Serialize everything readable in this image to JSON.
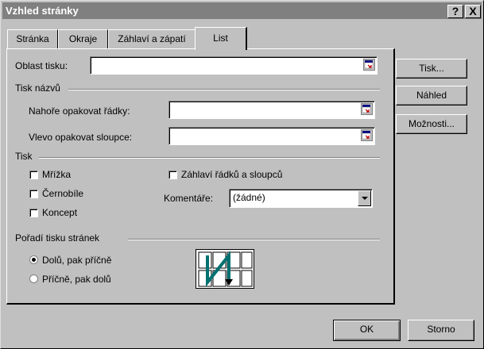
{
  "window": {
    "title": "Vzhled stránky",
    "help_label": "?",
    "close_label": "X"
  },
  "tabs": [
    {
      "label": "Stránka",
      "active": false
    },
    {
      "label": "Okraje",
      "active": false
    },
    {
      "label": "Záhlaví a zápatí",
      "active": false
    },
    {
      "label": "List",
      "active": true
    }
  ],
  "print_area": {
    "label": "Oblast tisku:",
    "value": ""
  },
  "print_titles": {
    "heading": "Tisk názvů",
    "rows_label": "Nahoře opakovat řádky:",
    "rows_value": "",
    "cols_label": "Vlevo opakovat sloupce:",
    "cols_value": ""
  },
  "print": {
    "heading": "Tisk",
    "gridlines": {
      "label": "Mřížka",
      "checked": false
    },
    "black_white": {
      "label": "Černobíle",
      "checked": false
    },
    "draft": {
      "label": "Koncept",
      "checked": false
    },
    "headings": {
      "label": "Záhlaví řádků a sloupců",
      "checked": false
    },
    "comments_label": "Komentáře:",
    "comments_value": "(žádné)"
  },
  "page_order": {
    "heading": "Pořadí tisku stránek",
    "down_then_over": {
      "label": "Dolů, pak příčně",
      "selected": true
    },
    "over_then_down": {
      "label": "Příčně, pak dolů",
      "selected": false
    }
  },
  "side_buttons": {
    "print": "Tisk...",
    "preview": "Náhled",
    "options": "Možnosti..."
  },
  "footer": {
    "ok": "OK",
    "cancel": "Storno"
  },
  "colors": {
    "face": "#c0c0c0",
    "title_bar": "#808080",
    "diagram_arrow": "#007070"
  }
}
